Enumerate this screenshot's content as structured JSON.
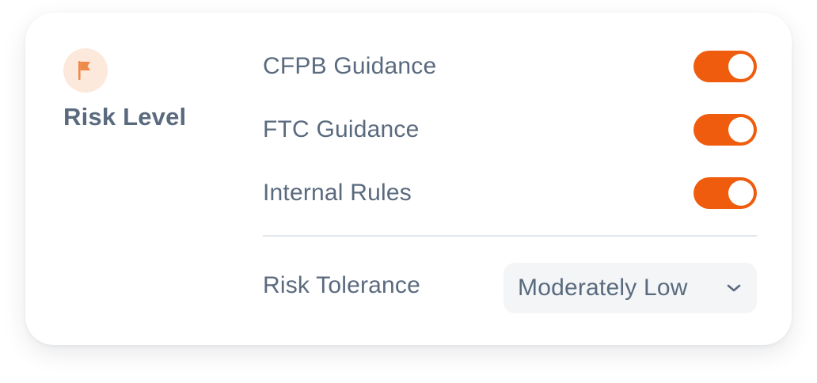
{
  "panel": {
    "icon": "flag-icon",
    "title": "Risk Level"
  },
  "toggles": [
    {
      "label": "CFPB Guidance",
      "on": true
    },
    {
      "label": "FTC Guidance",
      "on": true
    },
    {
      "label": "Internal Rules",
      "on": true
    }
  ],
  "tolerance": {
    "label": "Risk Tolerance",
    "selected": "Moderately Low",
    "icon": "chevron-down-icon"
  },
  "colors": {
    "accent": "#ef5c0d",
    "badge_bg": "#fde8dc",
    "text": "#5a6a7e",
    "select_bg": "#f3f5f7"
  }
}
